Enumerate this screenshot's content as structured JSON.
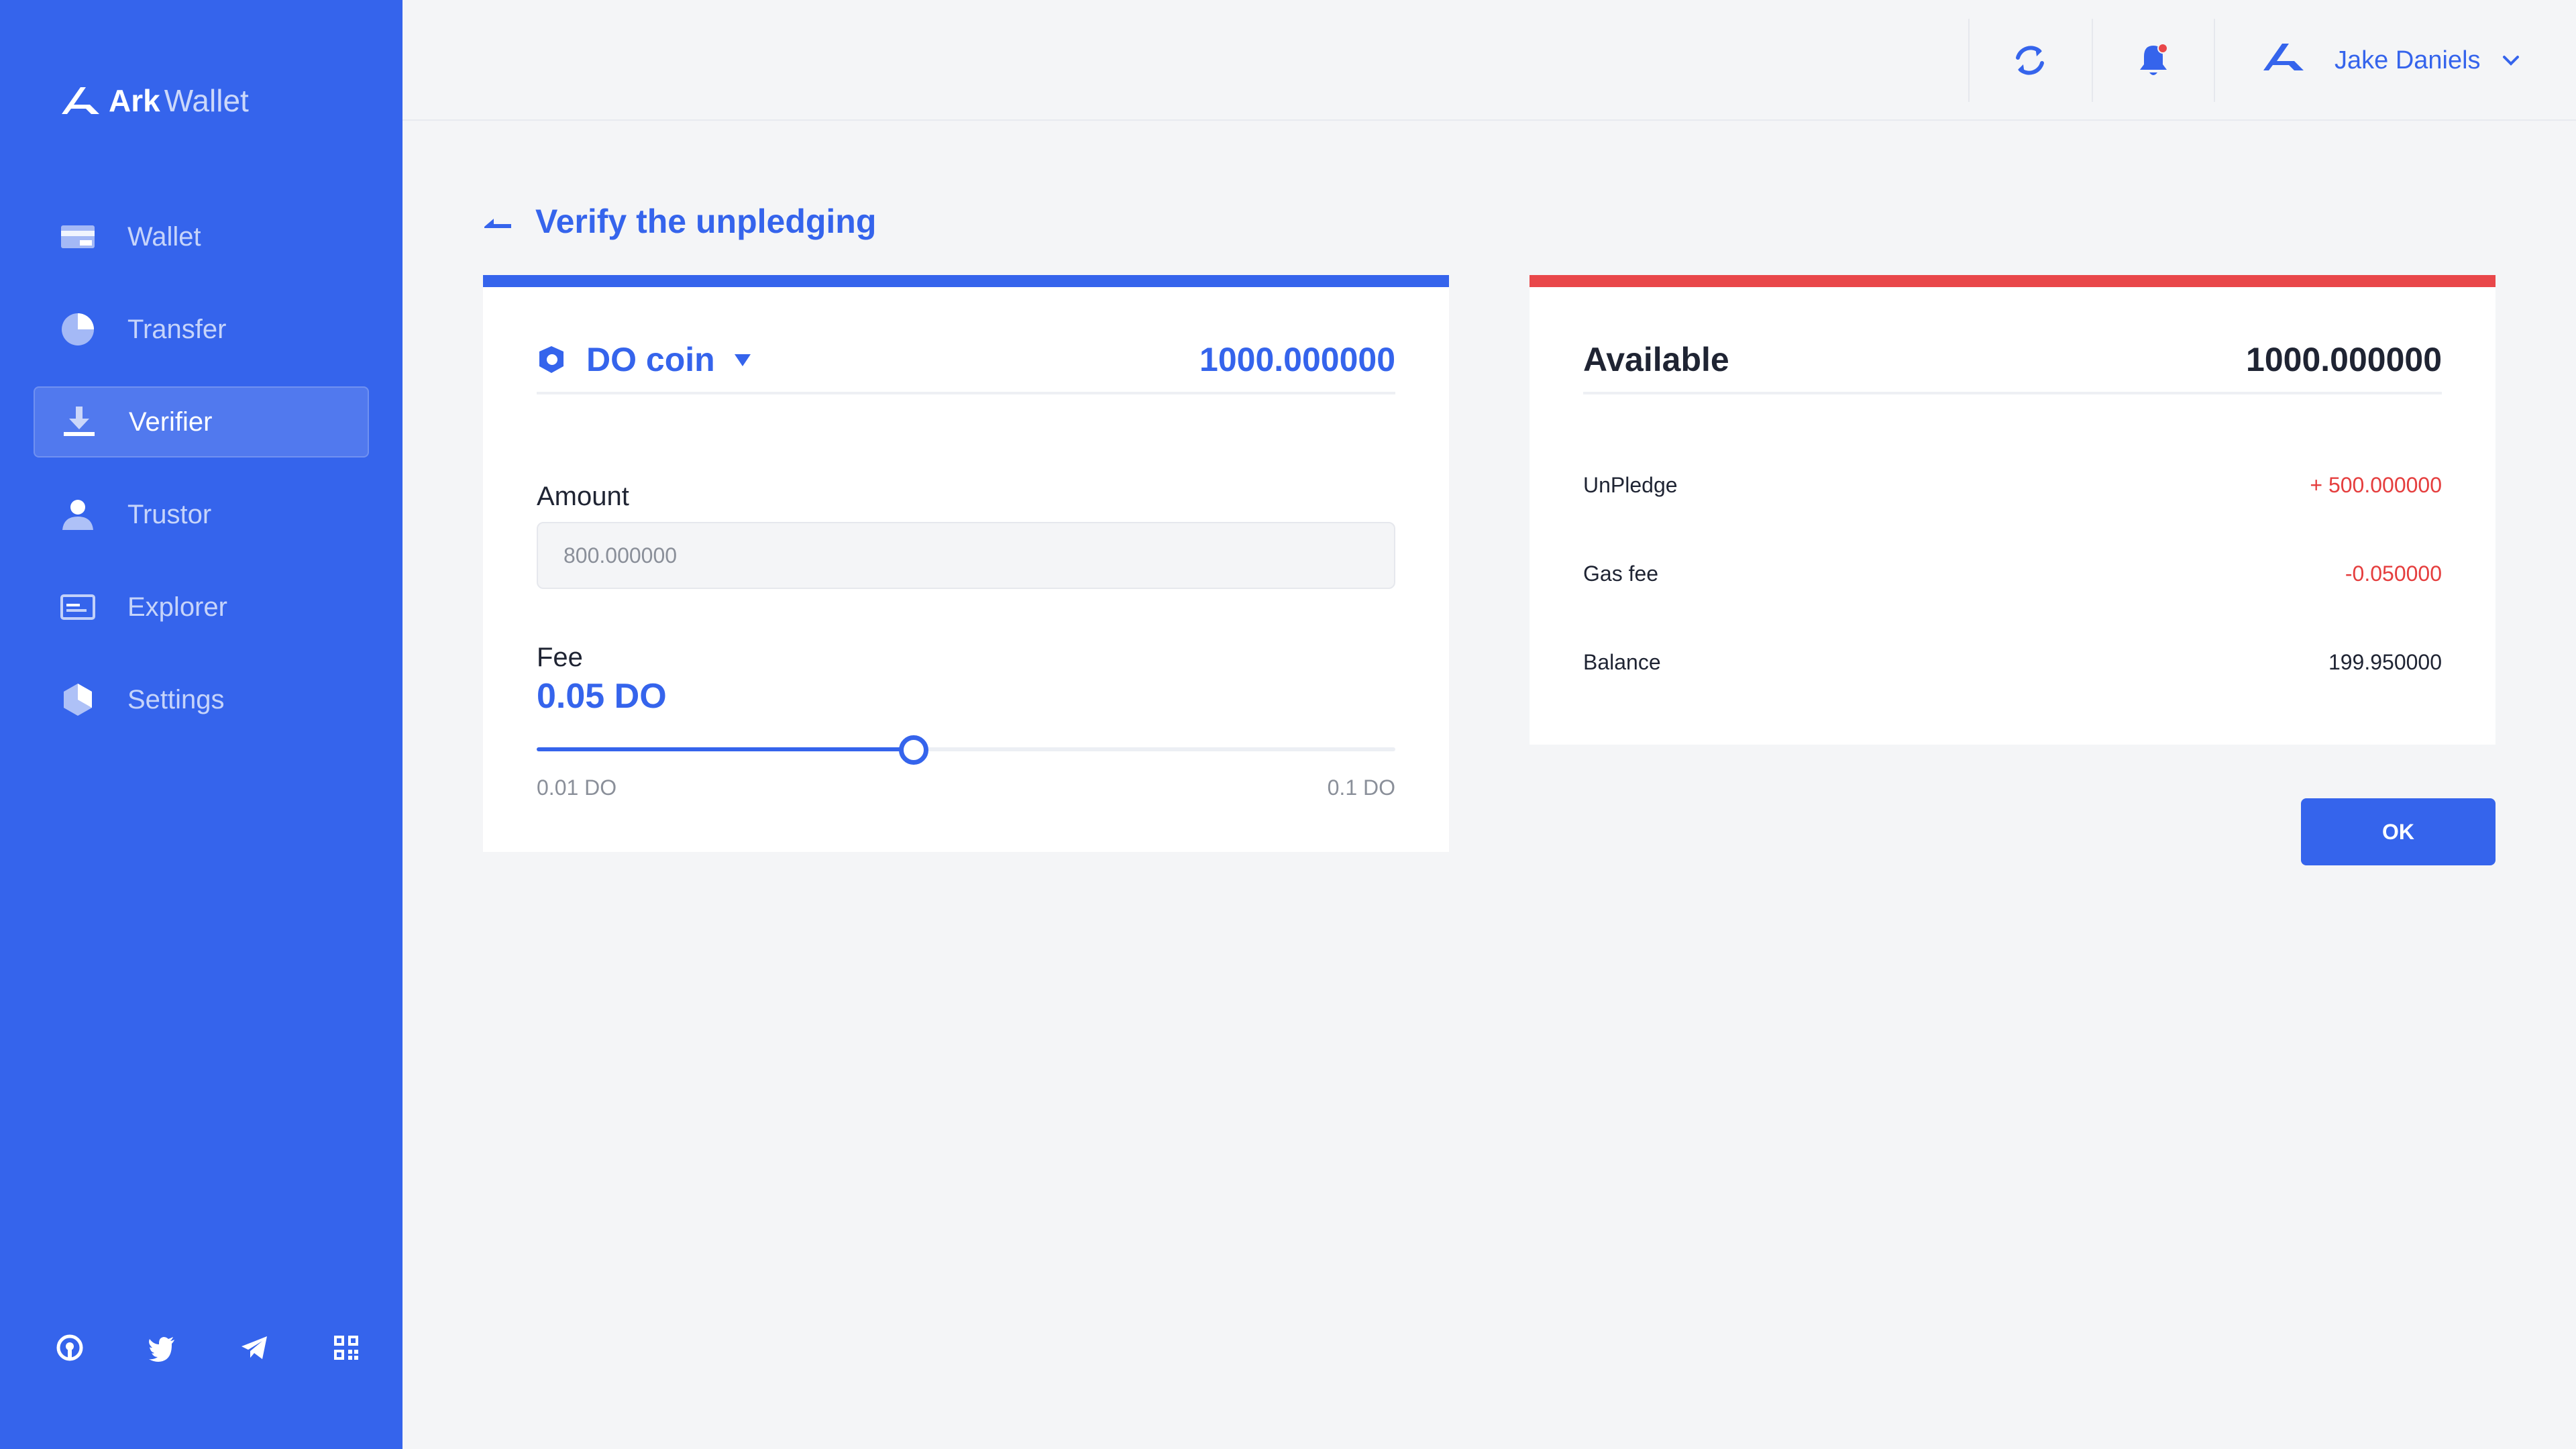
{
  "app": {
    "brand_bold": "Ark",
    "brand_light": "Wallet"
  },
  "sidebar": {
    "items": [
      {
        "label": "Wallet",
        "icon": "wallet-icon",
        "active": false
      },
      {
        "label": "Transfer",
        "icon": "pie-chart-icon",
        "active": false
      },
      {
        "label": "Verifier",
        "icon": "download-icon",
        "active": true
      },
      {
        "label": "Trustor",
        "icon": "user-icon",
        "active": false
      },
      {
        "label": "Explorer",
        "icon": "browser-window-icon",
        "active": false
      },
      {
        "label": "Settings",
        "icon": "hexagon-settings-icon",
        "active": false
      }
    ],
    "social": [
      "github-icon",
      "twitter-icon",
      "telegram-icon",
      "qr-code-icon"
    ]
  },
  "header": {
    "user_name": "Jake Daniels",
    "notification_dot": true
  },
  "page": {
    "title": "Verify the unpledging"
  },
  "pledge_form": {
    "coin_name": "DO coin",
    "coin_balance": "1000.000000",
    "amount_label": "Amount",
    "amount_placeholder": "800.000000",
    "fee_label": "Fee",
    "fee_value": "0.05 DO",
    "fee_min_label": "0.01 DO",
    "fee_max_label": "0.1 DO",
    "fee_min": 0.01,
    "fee_max": 0.1,
    "fee_current": 0.05
  },
  "summary": {
    "available_label": "Available",
    "available_value": "1000.000000",
    "rows": [
      {
        "label": "UnPledge",
        "value": "+ 500.000000",
        "tone": "pos"
      },
      {
        "label": "Gas fee",
        "value": "-0.050000",
        "tone": "neg"
      },
      {
        "label": "Balance",
        "value": "199.950000",
        "tone": "plain"
      }
    ]
  },
  "actions": {
    "ok_label": "OK"
  },
  "colors": {
    "primary": "#3564ec",
    "danger": "#e9474a",
    "background": "#f4f5f7"
  }
}
